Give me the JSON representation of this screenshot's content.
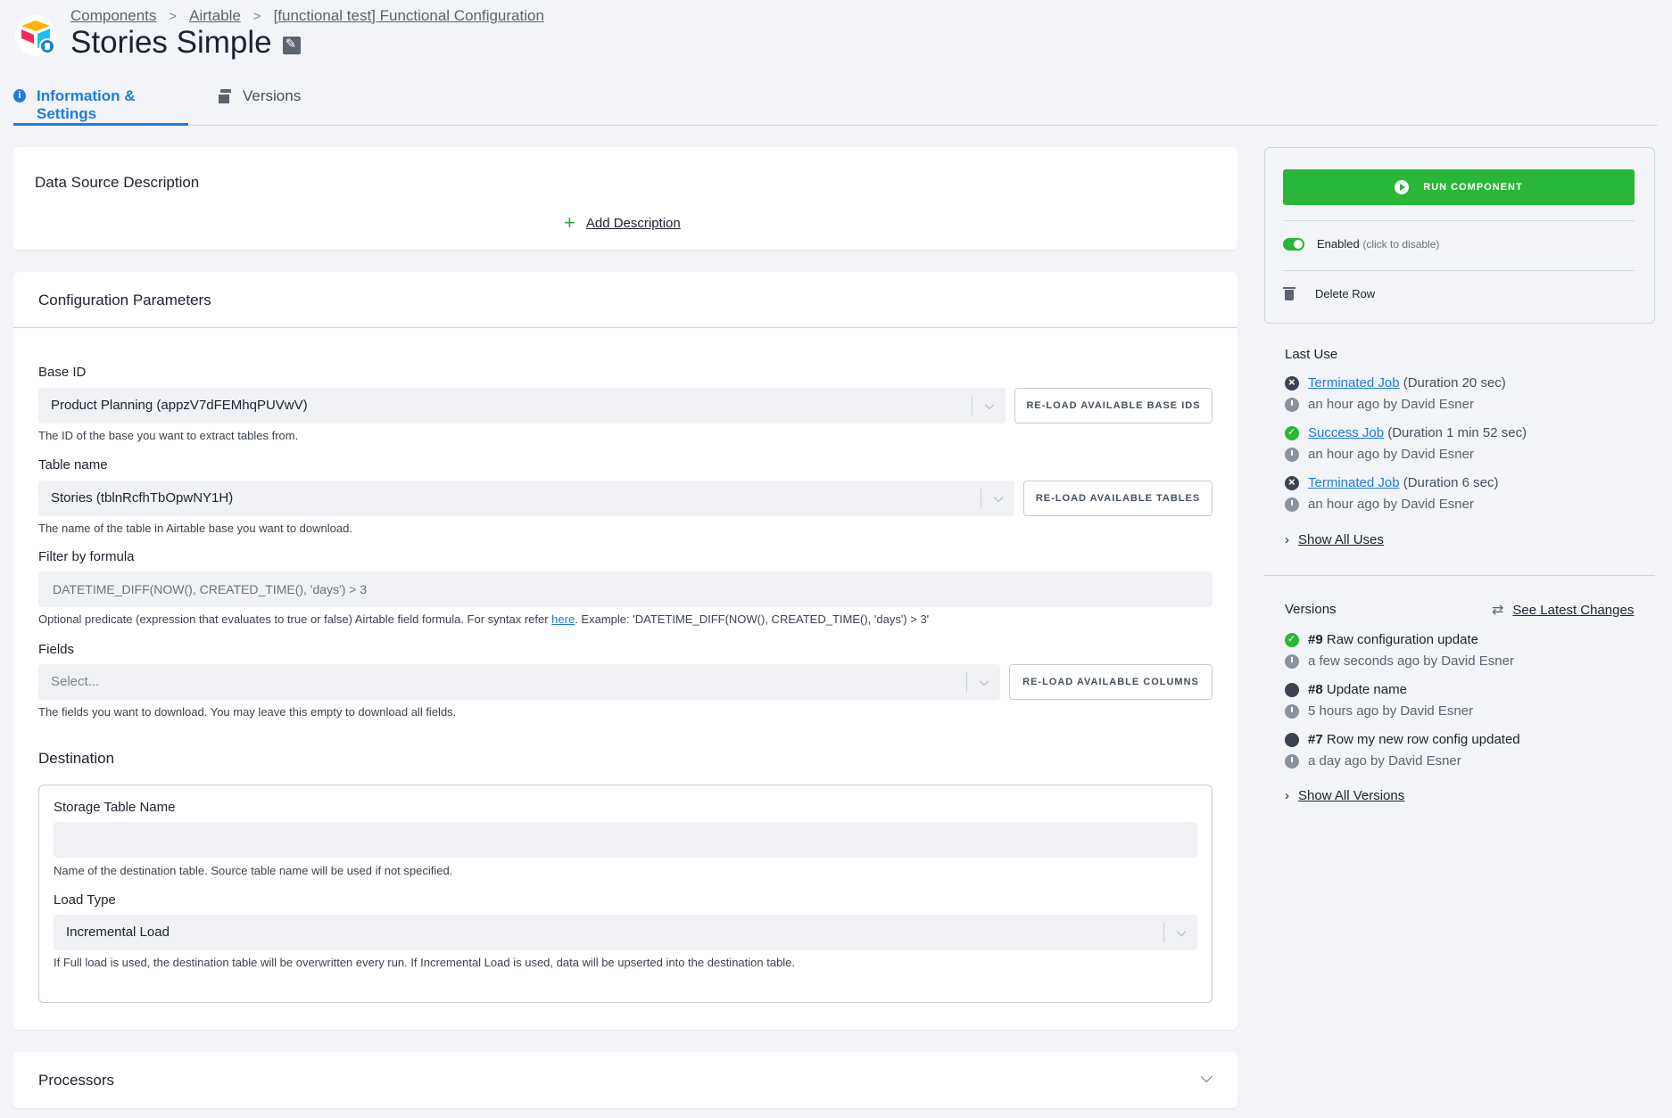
{
  "breadcrumb": [
    "Components",
    "Airtable",
    "[functional test] Functional Configuration"
  ],
  "page_title": "Stories Simple",
  "tabs": [
    {
      "label": "Information & Settings",
      "active": true
    },
    {
      "label": "Versions",
      "active": false
    }
  ],
  "description": {
    "title": "Data Source Description",
    "add_label": "Add Description"
  },
  "config": {
    "title": "Configuration Parameters",
    "base_id": {
      "label": "Base ID",
      "value": "Product Planning (appzV7dFEMhqPUVwV)",
      "button": "RE-LOAD AVAILABLE BASE IDS",
      "help": "The ID of the base you want to extract tables from."
    },
    "table_name": {
      "label": "Table name",
      "value": "Stories (tblnRcfhTbOpwNY1H)",
      "button": "RE-LOAD AVAILABLE TABLES",
      "help": "The name of the table in Airtable base you want to download."
    },
    "filter": {
      "label": "Filter by formula",
      "value": "DATETIME_DIFF(NOW(), CREATED_TIME(), 'days') > 3",
      "help_before": "Optional predicate (expression that evaluates to true or false) Airtable field formula. For syntax refer ",
      "help_link": "here",
      "help_after": ". Example: 'DATETIME_DIFF(NOW(), CREATED_TIME(), 'days') > 3'"
    },
    "fields": {
      "label": "Fields",
      "placeholder": "Select...",
      "button": "RE-LOAD AVAILABLE COLUMNS",
      "help": "The fields you want to download. You may leave this empty to download all fields."
    },
    "destination": {
      "title": "Destination",
      "storage_label": "Storage Table Name",
      "storage_value": "",
      "storage_help": "Name of the destination table. Source table name will be used if not specified.",
      "load_label": "Load Type",
      "load_value": "Incremental Load",
      "load_help": "If Full load is used, the destination table will be overwritten every run. If Incremental Load is used, data will be upserted into the destination table."
    }
  },
  "processors": {
    "title": "Processors"
  },
  "sidebar": {
    "run_label": "RUN COMPONENT",
    "enabled_label": "Enabled",
    "enabled_hint": "(click to disable)",
    "enabled": true,
    "delete_label": "Delete Row",
    "last_use": {
      "title": "Last Use",
      "items": [
        {
          "status": "terminated",
          "job": "Terminated Job",
          "duration": "(Duration 20 sec)",
          "when": "an hour ago by David Esner"
        },
        {
          "status": "success",
          "job": "Success Job",
          "duration": "(Duration 1 min 52 sec)",
          "when": "an hour ago by David Esner"
        },
        {
          "status": "terminated",
          "job": "Terminated Job",
          "duration": "(Duration 6 sec)",
          "when": "an hour ago by David Esner"
        }
      ],
      "show_all": "Show All Uses"
    },
    "versions": {
      "title": "Versions",
      "see_latest": "See Latest Changes",
      "items": [
        {
          "num": "#9",
          "desc": "Raw configuration update",
          "when": "a few seconds ago by David Esner",
          "status": "success"
        },
        {
          "num": "#8",
          "desc": "Update name",
          "when": "5 hours ago by David Esner",
          "status": "dark"
        },
        {
          "num": "#7",
          "desc": "Row my new row config updated",
          "when": "a day ago by David Esner",
          "status": "dark"
        }
      ],
      "show_all": "Show All Versions"
    }
  },
  "colors": {
    "accent": "#1f7ae0",
    "success": "#28b738",
    "background": "#f2f4f7"
  }
}
